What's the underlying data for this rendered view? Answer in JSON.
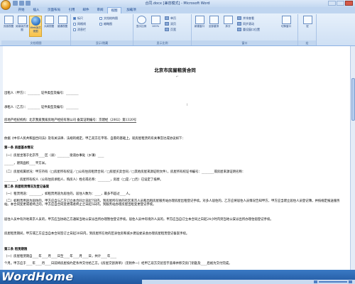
{
  "window": {
    "title": "合同.docx [兼容模式] - Microsoft Word"
  },
  "tabs": [
    "开始",
    "插入",
    "页面布局",
    "引用",
    "邮件",
    "审阅",
    "视图",
    "加载项"
  ],
  "active_tab": "视图",
  "ribbon": {
    "groups": {
      "views": {
        "label": "文档视图",
        "buttons": [
          "页面视图",
          "阅读版式视图",
          "Web版式视图",
          "大纲视图",
          "普通视图"
        ]
      },
      "show": {
        "label": "显示/隐藏",
        "checks": [
          "标尺",
          "网格线",
          "消息栏",
          "文档结构图",
          "缩略图"
        ]
      },
      "zoom": {
        "label": "显示比例",
        "buttons": [
          "显示比例",
          "100%",
          "单页",
          "双页",
          "页宽"
        ]
      },
      "window": {
        "label": "窗口",
        "buttons": [
          "新建窗口",
          "全部重排",
          "拆分",
          "并排查看",
          "同步滚动",
          "重设窗口位置",
          "切换窗口"
        ]
      },
      "macro": {
        "label": "宏",
        "buttons": [
          "宏"
        ]
      }
    }
  },
  "document": {
    "title": "北京市房屋租赁合同",
    "lines": [
      "出租人（甲方）：________  证件类型及编号：________",
      "承租人（乙方）：________  证件类型及编号：________",
      "房地产经纪机构：北京我爱我家房地产经纪有限公司  备案证明编号：京建经（2002）第1320号",
      "依据《中华人民共和国合同法》及有关法律、法规的规定，甲乙双方在平等、自愿的基础上，就房屋租赁的有关事宜达成协议如下：",
      "第一条  房屋基本情况",
      "（一）房屋坐落于北京市____区（县）________街道办事处（乡镇）____",
      "______，建筑面积____平方米。",
      "（二）房屋权属状况：甲方持有（□房屋所有权证／□公有住房租赁合同／□房屋买卖合同／□其他房屋来源证明文件），房屋所有权证书编号：________或房屋来源证明名称：",
      "________，房屋所有权人（公有住房承租人、购房人）姓名或名称：________，房屋（□是／□否）已设定了抵押。",
      "第二条  房屋租赁情况及登记备案",
      "（一）租赁用途：________，如租赁用途为居住的，居住人数为：____，最多不超过____人。",
      "（二）如租赁用途为居住的，甲方应自与乙方订立本合同之日起7日内，到房屋所在地的社区来京人员和出租房屋服务站办理房屋出租登记手续。对多人居住的，乙方应将居住人员情况告知甲方，甲方应当建立居住人员登记簿，并按规定报送服务站。本合同变更或者终止的，甲方应自合同变更或者终止之日起5日内，到服务站办理房屋出租变更登记手续。",
      "居住人员中有外地来京人员的，甲方应当协助乙方通知当地公安派出所办理暂住登记手续。居住人员中有境外人员的，甲方应当自订立本合同之日起24小时内到当地公安派出所办理住宿登记手续。",
      "房屋租赁期间，甲方或乙方应当自本合同签订之日起30日内，到房屋所在地的区县住房和城乡建设委员会办理房屋租赁登记备案手续。",
      "第三条  租赁期限",
      "（一）房屋租赁期自____年____月____日至____年____月____日，共计____年____",
      "个月。甲方应于____年____月____日前将房屋按约定条件交付给乙方。《房屋交割清单》（见附件一）经甲乙双方交验签字盖章并移交房门钥匙及____后视为交付完成。"
    ]
  },
  "branding": {
    "logo": "WordHome",
    "logo_sub": ""
  },
  "colors": {
    "ribbon": "#dbe8f7",
    "statusbar": "#2e6ab5",
    "accent": "#f8c24c"
  }
}
